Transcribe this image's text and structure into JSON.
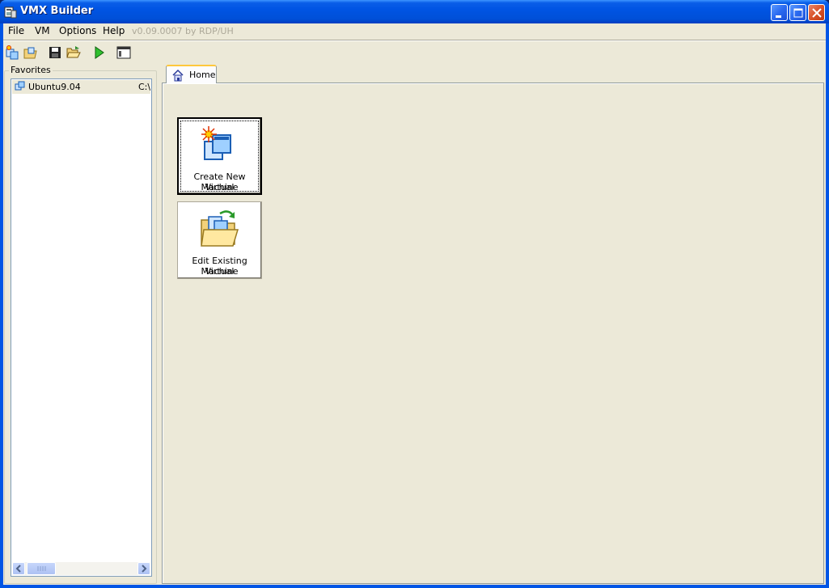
{
  "window": {
    "title": "VMX Builder"
  },
  "menu": {
    "items": [
      "File",
      "VM",
      "Options",
      "Help"
    ],
    "version": "v0.09.0007 by RDP/UH"
  },
  "toolbar": {
    "buttons": [
      "new-vm-icon",
      "edit-vm-icon",
      "save-icon",
      "open-folder-icon",
      "run-icon",
      "window-layout-icon"
    ]
  },
  "favorites": {
    "label": "Favorites",
    "items": [
      {
        "name": "Ubuntu9.04",
        "path": "C:\\"
      }
    ]
  },
  "tabs": [
    {
      "label": "Home"
    }
  ],
  "home": {
    "create_label_1": "Create New Virtual",
    "create_label_2": "Machine",
    "edit_label_1": "Edit Existing Virtual",
    "edit_label_2": "Machine"
  },
  "colors": {
    "titlebar": "#0054e3",
    "client": "#ece9d8",
    "tab_highlight": "#ffc83c"
  }
}
